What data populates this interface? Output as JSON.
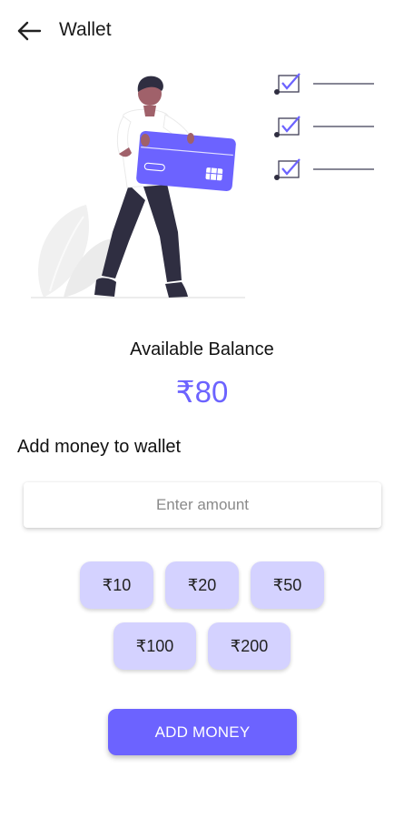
{
  "colors": {
    "accent": "#6c63ff",
    "chip": "#d4d2ff",
    "illustration_dark": "#2f2e41",
    "illustration_light": "#f0f0f0"
  },
  "header": {
    "back_icon": "arrow-left-icon",
    "title": "Wallet"
  },
  "illustration": {
    "name": "person-holding-credit-card-illustration"
  },
  "balance": {
    "label": "Available Balance",
    "value": "₹80"
  },
  "add_money": {
    "title": "Add money to wallet",
    "input_placeholder": "Enter amount",
    "input_value": "",
    "quick_amounts_row1": [
      "₹10",
      "₹20",
      "₹50"
    ],
    "quick_amounts_row2": [
      "₹100",
      "₹200"
    ],
    "button_label": "ADD MONEY"
  }
}
